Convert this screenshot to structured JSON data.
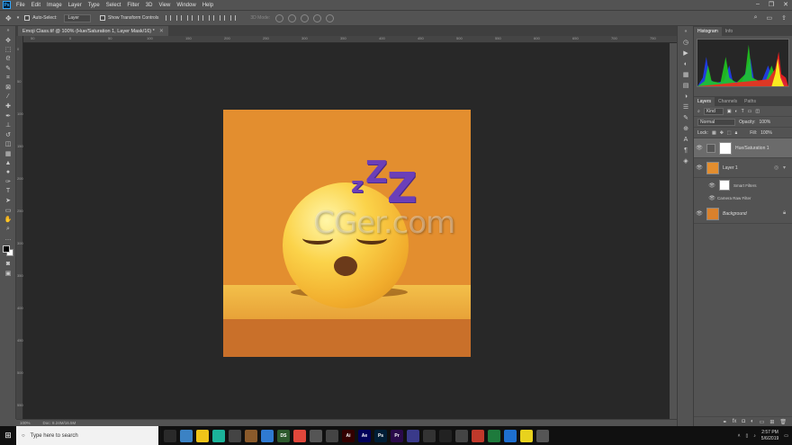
{
  "menu": [
    "File",
    "Edit",
    "Image",
    "Layer",
    "Type",
    "Select",
    "Filter",
    "3D",
    "View",
    "Window",
    "Help"
  ],
  "options": {
    "auto_select_label": "Auto-Select:",
    "auto_select_value": "Layer",
    "show_transform_label": "Show Transform Controls",
    "mode3d_label": "3D Mode:"
  },
  "document": {
    "tab_title": "Emoji Class.tif @ 100% (Hue/Saturation 1, Layer Mask/16) *",
    "zoom": "100%",
    "doc_size": "Doc: 8.24M/16.5M"
  },
  "ruler_top": [
    "50",
    "0",
    "50",
    "100",
    "150",
    "200",
    "250",
    "300",
    "350",
    "400",
    "450",
    "500",
    "550",
    "600",
    "650",
    "700",
    "750"
  ],
  "ruler_left": [
    "0",
    "50",
    "100",
    "150",
    "200",
    "250",
    "300",
    "350",
    "400",
    "450",
    "500",
    "550"
  ],
  "watermark": "CGer.com",
  "zzz": [
    "z",
    "Z",
    "Z"
  ],
  "panels": {
    "top_tabs": [
      "Histogram",
      "Info"
    ],
    "layers_tabs": [
      "Layers",
      "Channels",
      "Paths"
    ],
    "kind_label": "Kind",
    "blend_mode": "Normal",
    "opacity_label": "Opacity:",
    "opacity_value": "100%",
    "lock_label": "Lock:",
    "fill_label": "Fill:",
    "fill_value": "100%",
    "layers": [
      {
        "name": "Hue/Saturation 1"
      },
      {
        "name": "Layer 1"
      },
      {
        "name": "Smart Filters"
      },
      {
        "name": "Camera Raw Filter"
      },
      {
        "name": "Background"
      }
    ]
  },
  "taskbar": {
    "search_placeholder": "Type here to search",
    "time": "2:57 PM",
    "date": "5/6/2019",
    "apps": [
      {
        "label": "",
        "color": "#2a2a2a"
      },
      {
        "label": "",
        "color": "#3b82c4"
      },
      {
        "label": "",
        "color": "#f0c419"
      },
      {
        "label": "",
        "color": "#1bb39a"
      },
      {
        "label": "",
        "color": "#444444"
      },
      {
        "label": "",
        "color": "#8a5a2b"
      },
      {
        "label": "",
        "color": "#2f7ad1"
      },
      {
        "label": "DS",
        "color": "#2d5a2d"
      },
      {
        "label": "",
        "color": "#e0473b"
      },
      {
        "label": "",
        "color": "#555555"
      },
      {
        "label": "",
        "color": "#444444"
      },
      {
        "label": "Ai",
        "color": "#330000"
      },
      {
        "label": "Ae",
        "color": "#00005b"
      },
      {
        "label": "Ps",
        "color": "#001e36"
      },
      {
        "label": "Pr",
        "color": "#2a0a4a"
      },
      {
        "label": "",
        "color": "#3a3a8a"
      },
      {
        "label": "",
        "color": "#333333"
      },
      {
        "label": "",
        "color": "#222222"
      },
      {
        "label": "",
        "color": "#444444"
      },
      {
        "label": "",
        "color": "#c0392b"
      },
      {
        "label": "",
        "color": "#1e7a3c"
      },
      {
        "label": "",
        "color": "#1e6fd0"
      },
      {
        "label": "",
        "color": "#e8d21d"
      },
      {
        "label": "",
        "color": "#555555"
      }
    ]
  }
}
